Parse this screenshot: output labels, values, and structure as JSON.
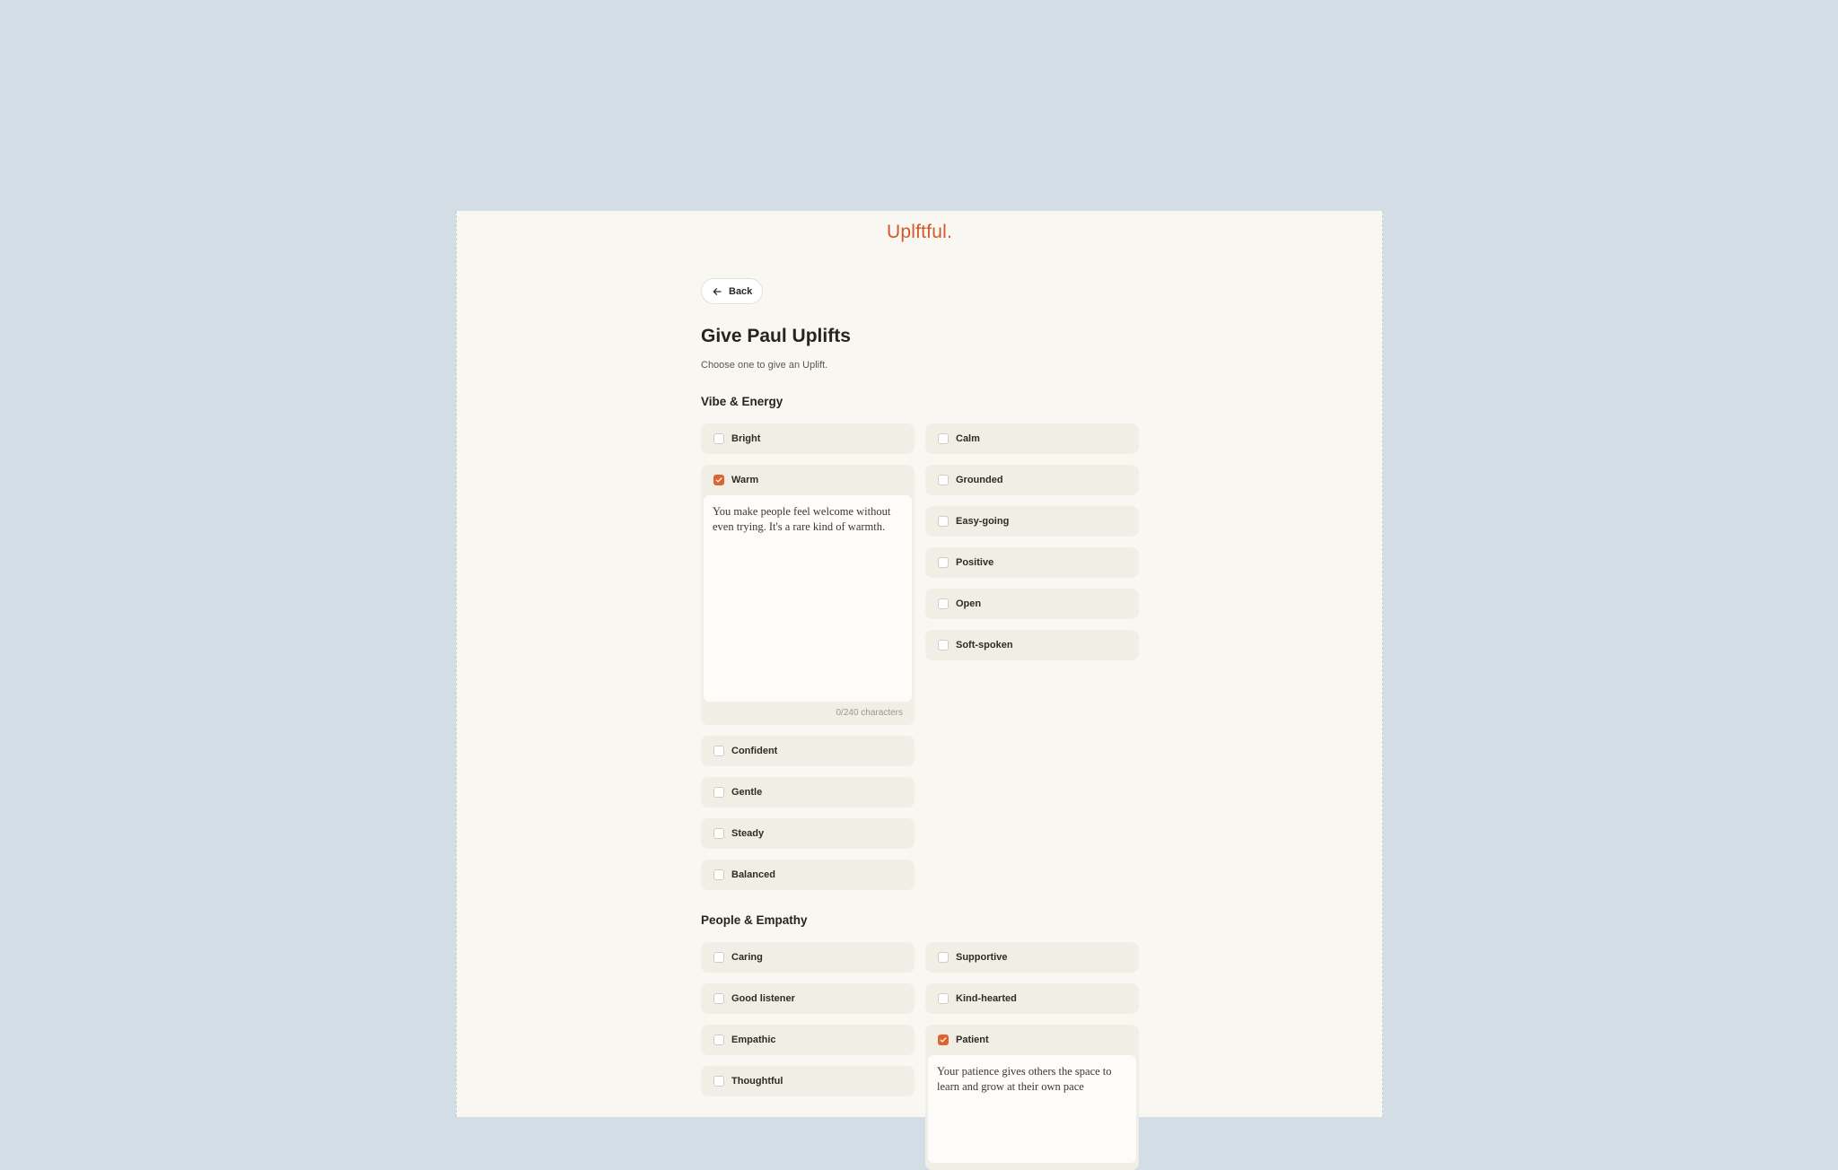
{
  "brand": {
    "logo": "Uplftful."
  },
  "back": {
    "label": "Back"
  },
  "page": {
    "title": "Give Paul Uplifts",
    "subtitle": "Choose one to give an Uplift."
  },
  "sections": [
    {
      "title": "Vibe & Energy",
      "left": [
        {
          "label": "Bright",
          "checked": false
        },
        {
          "label": "Warm",
          "checked": true,
          "note": "You make people feel welcome without even trying. It's a rare kind of warmth.",
          "counter": "0/240 characters"
        },
        {
          "label": "Confident",
          "checked": false
        },
        {
          "label": "Gentle",
          "checked": false
        },
        {
          "label": "Steady",
          "checked": false
        },
        {
          "label": "Balanced",
          "checked": false
        }
      ],
      "right": [
        {
          "label": "Calm",
          "checked": false
        },
        {
          "label": "Grounded",
          "checked": false
        },
        {
          "label": "Easy-going",
          "checked": false
        },
        {
          "label": "Positive",
          "checked": false
        },
        {
          "label": "Open",
          "checked": false
        },
        {
          "label": "Soft-spoken",
          "checked": false
        }
      ]
    },
    {
      "title": "People & Empathy",
      "left": [
        {
          "label": "Caring",
          "checked": false
        },
        {
          "label": "Good listener",
          "checked": false
        },
        {
          "label": "Empathic",
          "checked": false
        },
        {
          "label": "Thoughtful",
          "checked": false
        }
      ],
      "right": [
        {
          "label": "Supportive",
          "checked": false
        },
        {
          "label": "Kind-hearted",
          "checked": false
        },
        {
          "label": "Patient",
          "checked": true,
          "note": "Your patience gives others the space to learn and grow at their own pace"
        }
      ]
    }
  ],
  "colors": {
    "accent": "#e0622f",
    "page_bg": "#f8f7f2",
    "outer_bg": "#d3dde5",
    "option_bg": "#f1eee5"
  }
}
